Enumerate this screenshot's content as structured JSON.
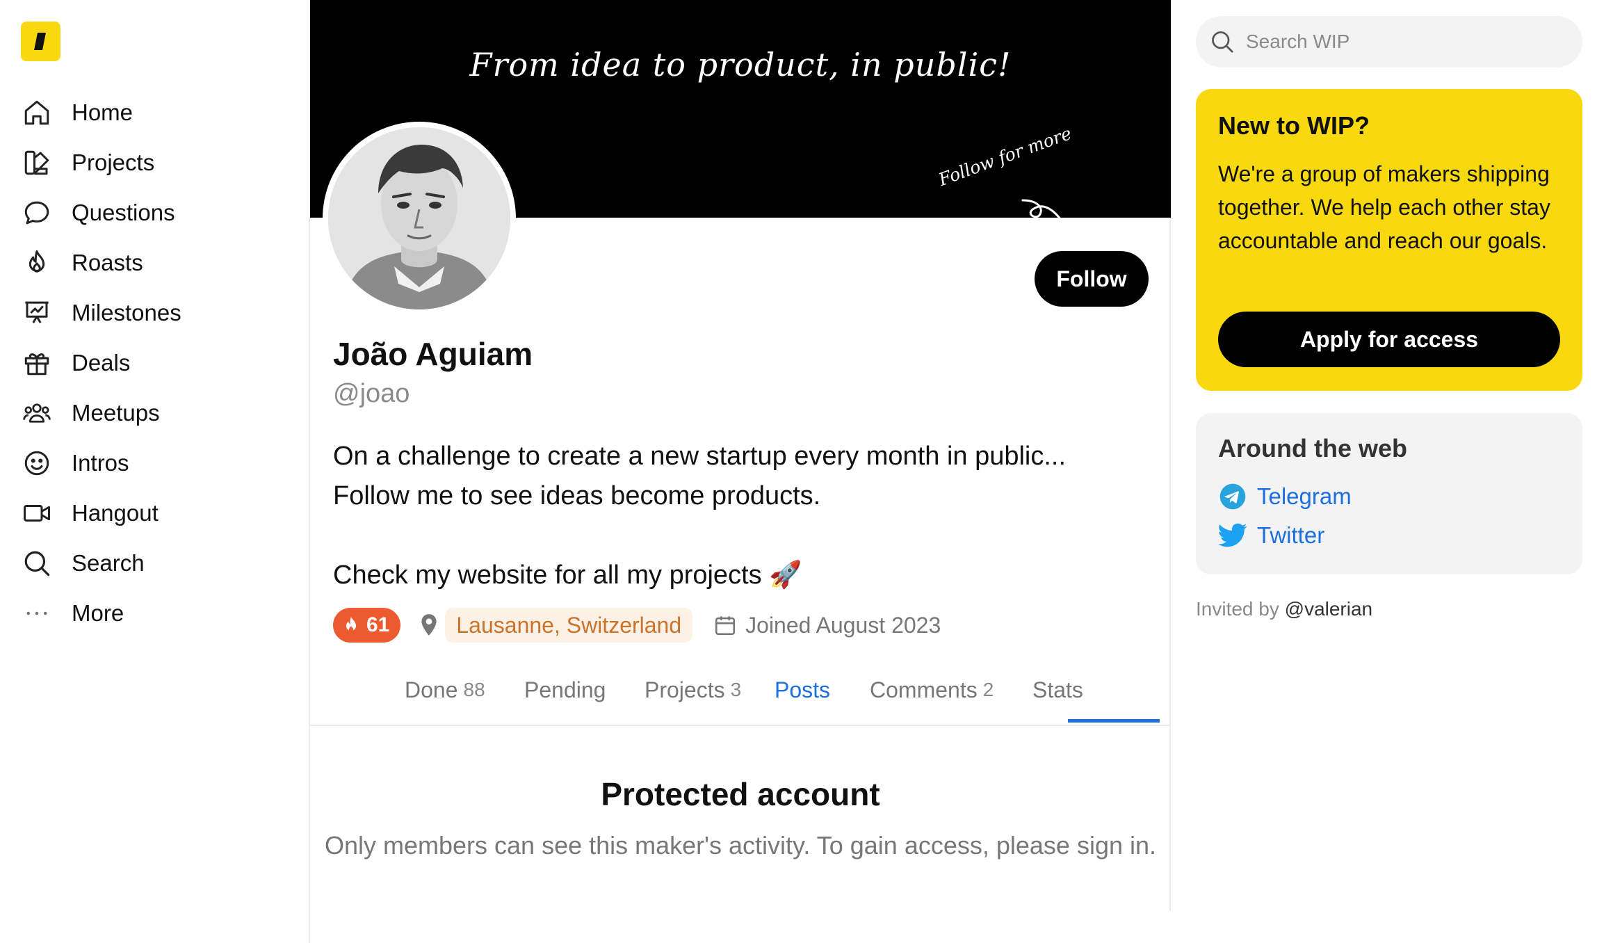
{
  "colors": {
    "brand_yellow": "#f8d90f",
    "accent_blue": "#1d6fe0",
    "streak_orange": "#ed5a2f",
    "location_bg": "#fdf1e6",
    "location_text": "#c9742a"
  },
  "sidebar": {
    "logo_icon": "wip-slash-logo-icon",
    "items": [
      {
        "label": "Home",
        "icon": "home-icon"
      },
      {
        "label": "Projects",
        "icon": "projects-icon"
      },
      {
        "label": "Questions",
        "icon": "speech-bubble-icon"
      },
      {
        "label": "Roasts",
        "icon": "flame-icon"
      },
      {
        "label": "Milestones",
        "icon": "presentation-chart-icon"
      },
      {
        "label": "Deals",
        "icon": "gift-icon"
      },
      {
        "label": "Meetups",
        "icon": "people-icon"
      },
      {
        "label": "Intros",
        "icon": "smiley-icon"
      },
      {
        "label": "Hangout",
        "icon": "video-camera-icon"
      },
      {
        "label": "Search",
        "icon": "search-icon"
      },
      {
        "label": "More",
        "icon": "ellipsis-icon"
      }
    ]
  },
  "profile": {
    "banner_title": "From idea to product, in public!",
    "banner_note": "Follow for more",
    "follow_label": "Follow",
    "name": "João Aguiam",
    "handle": "@joao",
    "bio_line1": "On a challenge to create a new startup every month in public...",
    "bio_line2": "Follow me to see ideas become products.",
    "bio_line3": "Check my website for all my projects 🚀",
    "streak": "61",
    "location": "Lausanne, Switzerland",
    "joined": "Joined August 2023"
  },
  "tabs": [
    {
      "label": "Done",
      "count": "88"
    },
    {
      "label": "Pending",
      "count": ""
    },
    {
      "label": "Projects",
      "count": "3"
    },
    {
      "label": "Posts",
      "count": "",
      "active": true
    },
    {
      "label": "Comments",
      "count": "2"
    },
    {
      "label": "Stats",
      "count": ""
    }
  ],
  "protected": {
    "title": "Protected account",
    "text": "Only members can see this maker's activity. To gain access, please sign in."
  },
  "right": {
    "search_placeholder": "Search WIP",
    "promo": {
      "title": "New to WIP?",
      "text": "We're a group of makers shipping together. We help each other stay accountable and reach our goals.",
      "button": "Apply for access"
    },
    "web": {
      "title": "Around the web",
      "links": [
        {
          "label": "Telegram",
          "icon": "telegram-icon"
        },
        {
          "label": "Twitter",
          "icon": "twitter-icon"
        }
      ]
    },
    "invited_prefix": "Invited by",
    "invited_user": "@valerian"
  }
}
